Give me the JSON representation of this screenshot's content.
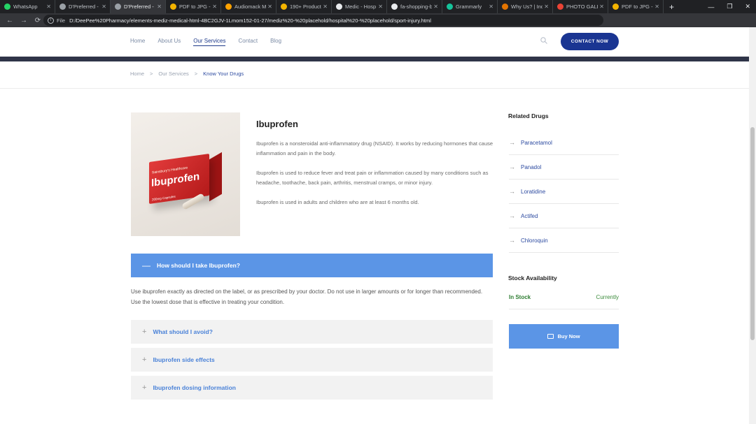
{
  "browser": {
    "tabs": [
      {
        "label": "WhatsApp",
        "color": "#25d366"
      },
      {
        "label": "D'Preferred -",
        "color": "#9aa0a6"
      },
      {
        "label": "D'Preferred -",
        "color": "#9aa0a6"
      },
      {
        "label": "PDF to JPG -",
        "color": "#f4b400"
      },
      {
        "label": "Audiomack M",
        "color": "#ffa200"
      },
      {
        "label": "190+ Product",
        "color": "#f4b400"
      },
      {
        "label": "Medic - Hosp",
        "color": "#e8eaed"
      },
      {
        "label": "fa-shopping-b",
        "color": "#e8eaed"
      },
      {
        "label": "Grammarly",
        "color": "#15c39a"
      },
      {
        "label": "Why Us? | Inc",
        "color": "#e37400"
      },
      {
        "label": "PHOTO GALLE",
        "color": "#ea4335"
      },
      {
        "label": "PDF to JPG -",
        "color": "#f4b400"
      }
    ],
    "active_tab": 2,
    "scheme": "File",
    "url": "D:/DeePee%20Pharmacy/elements-mediz-medical-html-4BC2GJV-1Lmom152-01-27/mediz%20-%20placehold/hospital%20-%20placehold/sport-injury.html"
  },
  "nav": {
    "items": [
      "Home",
      "About Us",
      "Our Services",
      "Contact",
      "Blog"
    ],
    "active": 2,
    "cta": "CONTACT NOW"
  },
  "breadcrumb": {
    "items": [
      "Home",
      "Our Services",
      "Know Your Drugs"
    ],
    "separator": ">"
  },
  "drug": {
    "title": "Ibuprofen",
    "image_text": {
      "brand": "Sainsbury's Healthcare",
      "name": "Ibuprofen",
      "dose": "200mg Capsules"
    },
    "paragraphs": [
      "Ibuprofen is a nonsteroidal anti-inflammatory drug (NSAID). It works by reducing hormones that cause inflammation and pain in the body.",
      "Ibuprofen is used to reduce fever and treat pain or inflammation caused by many conditions such as headache, toothache, back pain, arthritis, menstrual cramps, or minor injury.",
      "Ibuprofen is used in adults and children who are at least 6 months old."
    ]
  },
  "accordion": {
    "open": {
      "symbol": "—",
      "title": "How should I take Ibuprofen?",
      "body": "Use ibuprofen exactly as directed on the label, or as prescribed by your doctor. Do not use in larger amounts or for longer than recommended. Use the lowest dose that is effective in treating your condition."
    },
    "items": [
      {
        "symbol": "+",
        "title": "What should I avoid?"
      },
      {
        "symbol": "+",
        "title": "Ibuprofen side effects"
      },
      {
        "symbol": "+",
        "title": "Ibuprofen dosing information"
      }
    ]
  },
  "sidebar": {
    "related_heading": "Related Drugs",
    "related": [
      "Paracetamol",
      "Panadol",
      "Loratidine",
      "Actifed",
      "Chloroquin"
    ],
    "stock_heading": "Stock Availability",
    "stock_status": "In Stock",
    "stock_when": "Currently",
    "buy_label": "Buy Now"
  },
  "colors": {
    "brand": "#1a3592",
    "accent": "#5b95e6",
    "stock_green": "#2e7d32"
  }
}
